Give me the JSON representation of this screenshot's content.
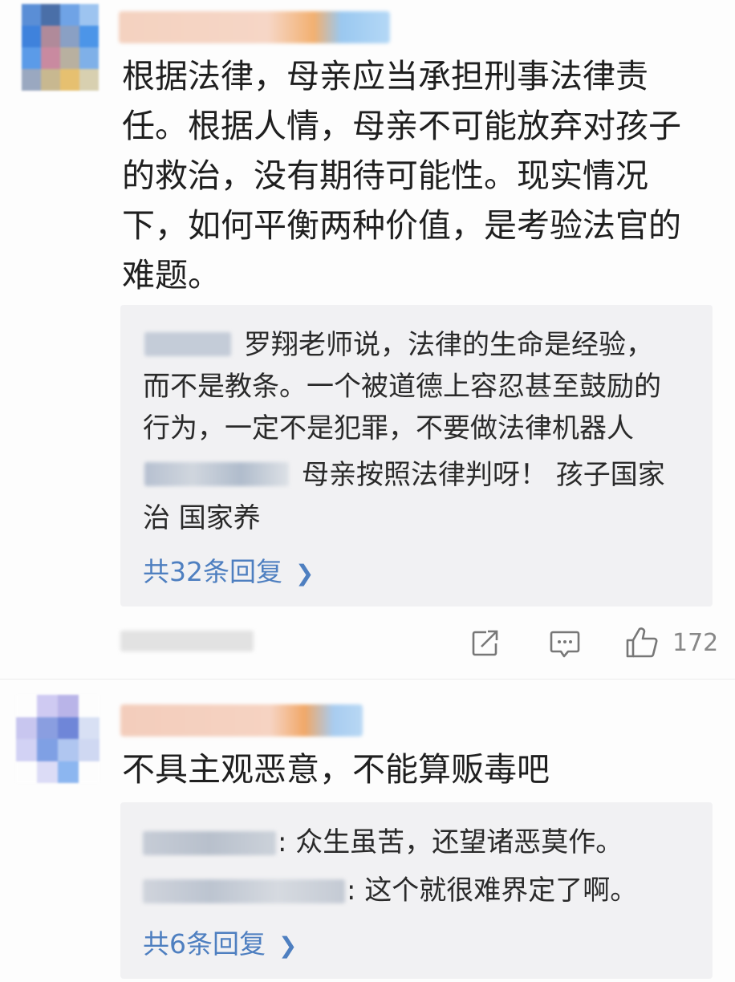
{
  "comments": [
    {
      "text_lines": [
        "根据法律，母亲应当承担刑事法律责",
        "任。根据人情，母亲不可能放弃对孩子",
        "的救治，没有期待可能性。现实情况",
        "下，如何平衡两种价值，是考验法官的",
        "难题。"
      ],
      "replies": [
        {
          "lines": [
            "罗翔老师说，法律的生命是经验，",
            "而不是教条。一个被道德上容忍甚至鼓励的",
            "行为，一定不是犯罪，不要做法律机器人"
          ]
        },
        {
          "lines": [
            "母亲按照法律判呀！ 孩子国家",
            "治 国家养"
          ]
        }
      ],
      "more_replies": "共32条回复",
      "like_count": "172"
    },
    {
      "text_lines": [
        "不具主观恶意，不能算贩毒吧"
      ],
      "replies": [
        {
          "lines": [
            ": 众生虽苦，还望诸恶莫作。"
          ]
        },
        {
          "lines": [
            ": 这个就很难界定了啊。"
          ]
        }
      ],
      "more_replies": "共6条回复"
    }
  ],
  "icons": {
    "share": "share-icon",
    "comment": "comment-icon",
    "like": "thumbs-up-icon",
    "chevron": "chevron-right-icon"
  },
  "colors": {
    "link": "#4e7fc0",
    "reply_bg": "#f1f1f3",
    "text": "#1f1f1f"
  }
}
